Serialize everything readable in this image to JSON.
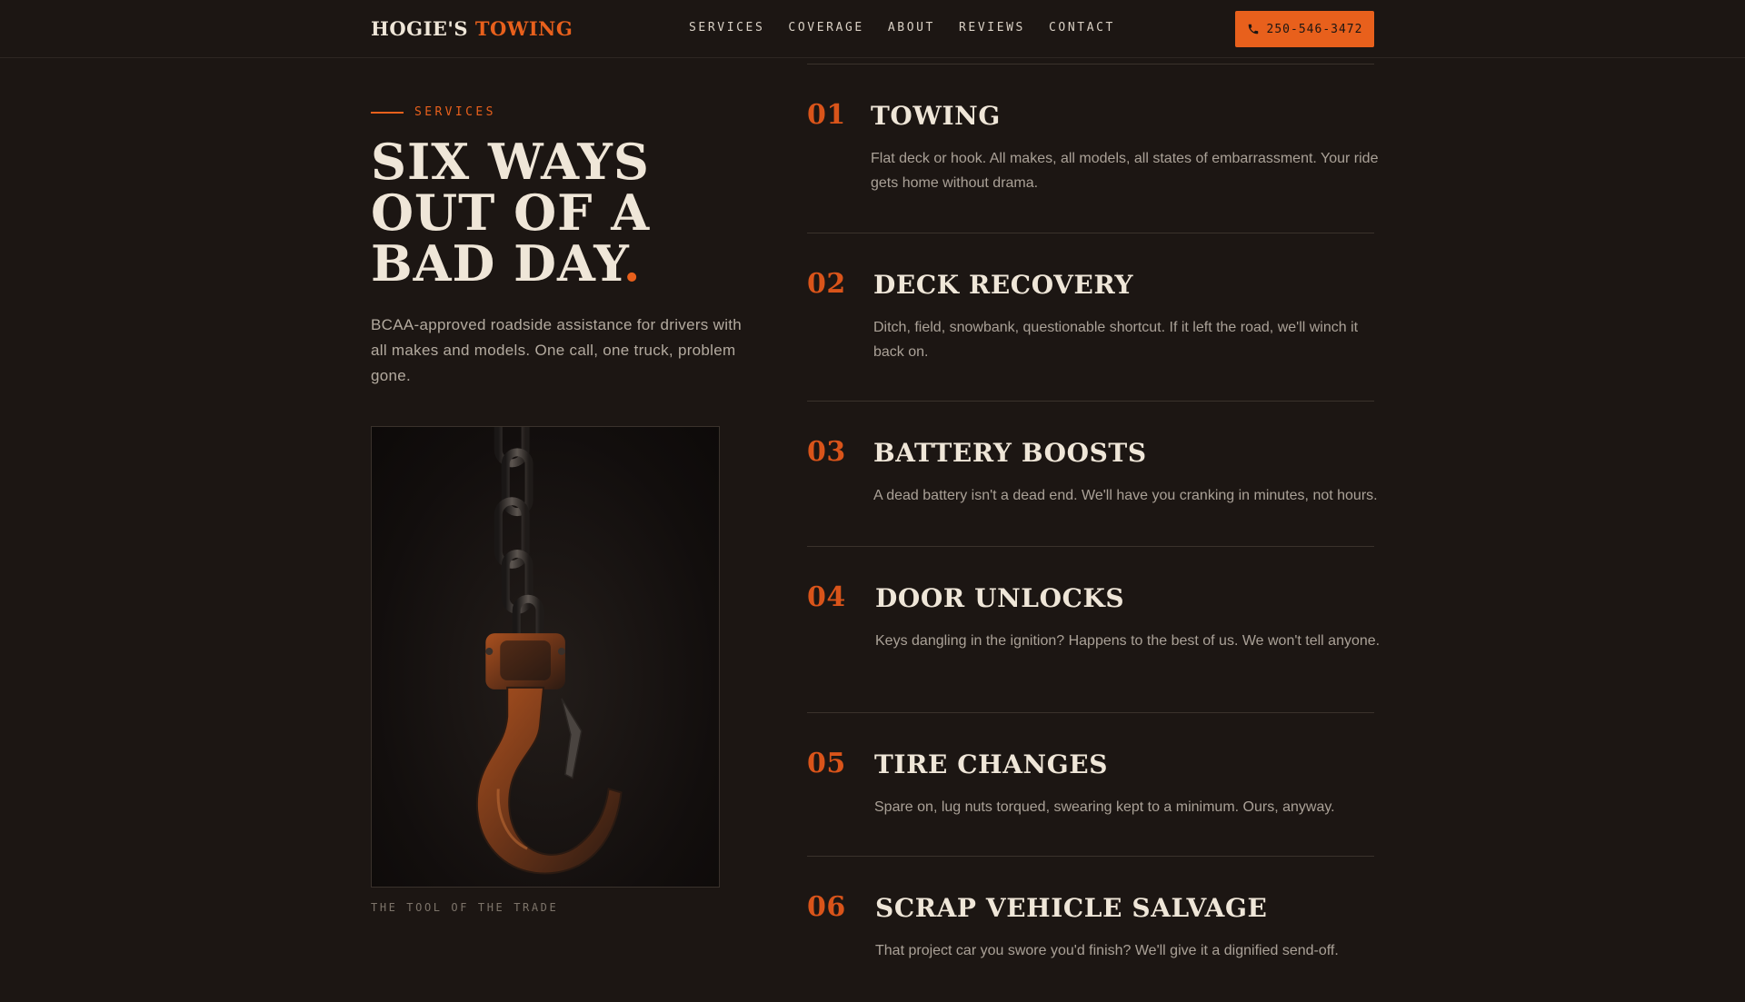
{
  "header": {
    "logo_part1": "HOGIE'S",
    "logo_part2": "TOWING",
    "nav": [
      "SERVICES",
      "COVERAGE",
      "ABOUT",
      "REVIEWS",
      "CONTACT"
    ],
    "phone": "250-546-3472",
    "phone_icon": "phone-icon"
  },
  "intro": {
    "eyebrow": "SERVICES",
    "headline_main": "SIX WAYS OUT OF A BAD DAY",
    "headline_dot": ".",
    "lede": "BCAA-approved roadside assistance for drivers with all makes and models. One call, one truck, problem gone.",
    "photo_caption": "THE TOOL OF THE TRADE"
  },
  "services": [
    {
      "number": "01",
      "title": "TOWING",
      "description": "Flat deck or hook. All makes, all models, all states of embarrassment. Your ride gets home without drama."
    },
    {
      "number": "02",
      "title": "DECK RECOVERY",
      "description": "Ditch, field, snowbank, questionable shortcut. If it left the road, we'll winch it back on."
    },
    {
      "number": "03",
      "title": "BATTERY BOOSTS",
      "description": "A dead battery isn't a dead end. We'll have you cranking in minutes, not hours."
    },
    {
      "number": "04",
      "title": "DOOR UNLOCKS",
      "description": "Keys dangling in the ignition? Happens to the best of us. We won't tell anyone."
    },
    {
      "number": "05",
      "title": "TIRE CHANGES",
      "description": "Spare on, lug nuts torqued, swearing kept to a minimum. Ours, anyway."
    },
    {
      "number": "06",
      "title": "SCRAP VEHICLE SALVAGE",
      "description": "That project car you swore you'd finish? We'll give it a dignified send-off."
    }
  ],
  "colors": {
    "background": "#1c1613",
    "accent": "#e8601c",
    "text": "#efe6d8",
    "muted": "#aaa197"
  }
}
